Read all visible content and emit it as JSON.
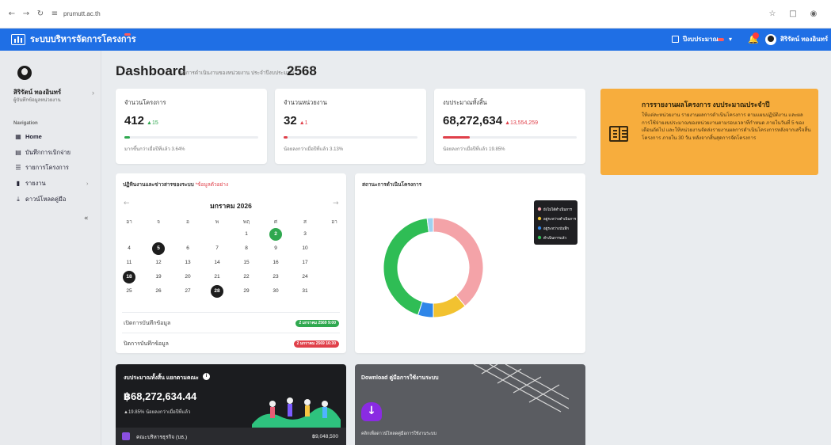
{
  "browser": {
    "back_icon": "arrow-left-icon",
    "forward_icon": "arrow-right-icon",
    "reload_icon": "reload-icon",
    "url": "prumutt.ac.th"
  },
  "header": {
    "app_title": "ระบบบริหารจัดการโครงการ",
    "budget_year_label": "ปีงบประมาณ",
    "user_name": "สิริรัตน์ ทองอินทร์",
    "accent": "#1f6fe5"
  },
  "sidebar": {
    "user_name": "สิริรัตน์ ทองอินทร์",
    "user_role": "ผู้บันทึกข้อมูลหน่วยงาน",
    "section_label": "Navigation",
    "items": [
      {
        "label": "Home",
        "icon": "grid-icon",
        "active": true
      },
      {
        "label": "บันทึกการเบิกจ่าย",
        "icon": "table-icon"
      },
      {
        "label": "รายการโครงการ",
        "icon": "list-icon"
      },
      {
        "label": "รายงาน",
        "icon": "document-icon"
      },
      {
        "label": "ดาวน์โหลดคู่มือ",
        "icon": "download-icon"
      }
    ]
  },
  "page": {
    "title": "Dashboard",
    "subtitle": "ผลการดำเนินงานของหน่วยงาน ประจำปีงบประมาณ",
    "year": "2568"
  },
  "stats": [
    {
      "label": "จำนวนโครงการ",
      "value": "412",
      "delta": "▲15",
      "note": "มากขึ้นกว่าเมื่อปีที่แล้ว 3.64%",
      "progress": 0.04,
      "color": "#2fa84f"
    },
    {
      "label": "จำนวนหน่วยงาน",
      "value": "32",
      "delta": "▲1",
      "note": "น้อยลงกว่าเมื่อปีที่แล้ว 3.13%",
      "progress": 0.03,
      "color": "#e0404a"
    },
    {
      "label": "งบประมาณทั้งสิ้น",
      "value": "68,272,634",
      "delta": "▲13,554,259",
      "note": "น้อยลงกว่าเมื่อปีที่แล้ว 19.85%",
      "progress": 0.2,
      "color": "#e0404a"
    }
  ],
  "notice": {
    "title": "การรายงานผลโครงการ งบประมาณประจำปี",
    "body": "ให้แต่ละหน่วยงาน รายงานผลการดำเนินโครงการ ตามแผนปฏิบัติงาน และผลการใช้จ่ายงบประมาณของหน่วยงานตามรอบเวลาที่กำหนด ภายในวันที่ 5 ของเดือนถัดไป และให้หน่วยงานจัดส่งรายงานผลการดำเนินโครงการหลังจากเสร็จสิ้นโครงการ ภายใน 30 วัน หลังจากสิ้นสุดการจัดโครงการ",
    "bg": "#f7ad3d"
  },
  "calendar": {
    "title": "ปฏิทินงานและข่าวสารของระบบ",
    "title_tag": "*ข้อมูลตัวอย่าง",
    "month": "มกราคม 2026",
    "weekdays": [
      "อา",
      "จ",
      "อ",
      "พ",
      "พฤ",
      "ศ",
      "ส",
      "อา"
    ],
    "days": [
      [
        "",
        "",
        "",
        "",
        "1",
        "2",
        "3",
        ""
      ],
      [
        "4",
        "5",
        "6",
        "7",
        "8",
        "9",
        "10",
        ""
      ],
      [
        "11",
        "12",
        "13",
        "14",
        "15",
        "16",
        "17",
        ""
      ],
      [
        "18",
        "19",
        "20",
        "21",
        "22",
        "23",
        "24",
        ""
      ],
      [
        "25",
        "26",
        "27",
        "28",
        "29",
        "30",
        "31",
        ""
      ]
    ],
    "highlight_dark": [
      "5",
      "18",
      "28"
    ],
    "highlight_green": [
      "2"
    ],
    "events": [
      {
        "label": "เปิดการบันทึกข้อมูล",
        "badge": "2 มกราคม 2569 9:00",
        "color": "#2fa84f"
      },
      {
        "label": "ปิดการบันทึกข้อมูล",
        "badge": "2 มกราคม 2569 16:30",
        "color": "#e0404a"
      }
    ]
  },
  "project_status": {
    "title": "สถานะการดำเนินโครงการ",
    "legend": [
      "ยังไม่ได้ดำเนินการ",
      "อยู่ระหว่างดำเนินการ",
      "อยู่ระหว่างบันทึก",
      "ดำเนินการแล้ว"
    ]
  },
  "chart_data": {
    "type": "pie",
    "title": "สถานะการดำเนินโครงการ",
    "categories": [
      "ยังไม่ได้ดำเนินการ",
      "อยู่ระหว่างดำเนินการ",
      "อยู่ระหว่างบันทึก",
      "ดำเนินการแล้ว"
    ],
    "values": [
      39,
      11,
      5,
      43
    ],
    "colors": [
      "#f4a3a8",
      "#f2c230",
      "#2f86e8",
      "#2fbd55"
    ],
    "other_value": 2,
    "other_color": "#9fd2f0",
    "legend_position": "top-right",
    "donut": true
  },
  "budget_card": {
    "label": "งบประมาณทั้งสิ้น แยกตามคณะ",
    "info_icon": "i",
    "value": "฿68,272,634.44",
    "note": "▲19.85% น้อยลงกว่าเมื่อปีที่แล้ว",
    "row_label": "คณะบริหารธุรกิจ (บธ.)",
    "row_value": "฿9,048,500"
  },
  "download_card": {
    "title": "Download คู่มือการใช้งานระบบ",
    "subtitle": "คลิกเพื่อดาวน์โหลดคู่มือการใช้งานระบบ"
  }
}
